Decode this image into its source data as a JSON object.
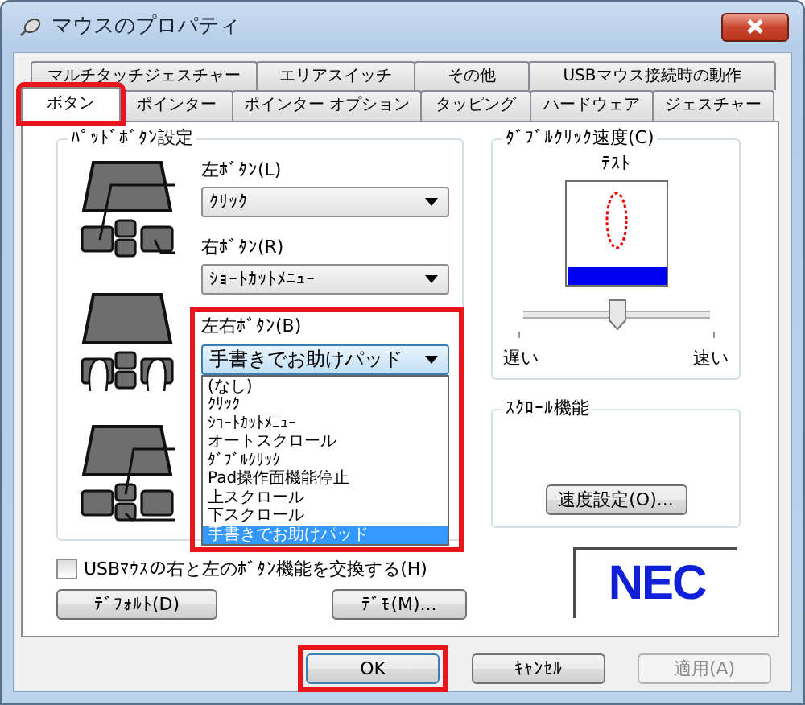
{
  "window": {
    "title": "マウスのプロパティ"
  },
  "tabs": {
    "back_row": [
      {
        "label": "マルチタッチジェスチャー",
        "selected": false
      },
      {
        "label": "エリアスイッチ",
        "selected": false
      },
      {
        "label": "その他",
        "selected": false
      },
      {
        "label": "USBマウス接続時の動作",
        "selected": false
      }
    ],
    "front_row": [
      {
        "label": "ボタン",
        "selected": true,
        "highlighted": true
      },
      {
        "label": "ポインター",
        "selected": false,
        "highlighted": false
      },
      {
        "label": "ポインター オプション",
        "selected": false,
        "highlighted": false
      },
      {
        "label": "タッピング",
        "selected": false,
        "highlighted": false
      },
      {
        "label": "ハードウェア",
        "selected": false,
        "highlighted": false
      },
      {
        "label": "ジェスチャー",
        "selected": false,
        "highlighted": false
      }
    ]
  },
  "pad_button_settings": {
    "title": "ﾊﾟｯﾄﾞﾎﾞﾀﾝ設定",
    "left": {
      "label": "左ﾎﾞﾀﾝ(L)",
      "value": "ｸﾘｯｸ"
    },
    "right": {
      "label": "右ﾎﾞﾀﾝ(R)",
      "value": "ｼｮｰﾄｶｯﾄﾒﾆｭｰ"
    },
    "both": {
      "label": "左右ﾎﾞﾀﾝ(B)",
      "value": "手書きでお助けパッド",
      "highlighted": true,
      "expanded": true,
      "options": [
        {
          "label": "(なし)",
          "selected": false
        },
        {
          "label": "ｸﾘｯｸ",
          "selected": false
        },
        {
          "label": "ｼｮｰﾄｶｯﾄﾒﾆｭｰ",
          "selected": false
        },
        {
          "label": "オートスクロール",
          "selected": false
        },
        {
          "label": "ﾀﾞﾌﾞﾙｸﾘｯｸ",
          "selected": false
        },
        {
          "label": "Pad操作面機能停止",
          "selected": false
        },
        {
          "label": "上スクロール",
          "selected": false
        },
        {
          "label": "下スクロール",
          "selected": false
        },
        {
          "label": "手書きでお助けパッド",
          "selected": true
        }
      ]
    }
  },
  "double_click_speed": {
    "title": "ﾀﾞﾌﾞﾙｸﾘｯｸ速度(C)",
    "test_label": "ﾃｽﾄ",
    "level": 0.5,
    "slow": "遅い",
    "fast": "速い"
  },
  "scroll": {
    "title": "ｽｸﾛｰﾙ機能",
    "button": "速度設定(O)..."
  },
  "swap_checkbox": {
    "label": "USBﾏｳｽの右と左のﾎﾞﾀﾝ機能を交換する(H)",
    "checked": false
  },
  "panel_buttons": [
    {
      "label": "ﾃﾞﾌｫﾙﾄ(D)"
    },
    {
      "label": "ﾃﾞﾓ(M)..."
    }
  ],
  "logo": "NEC",
  "footer_buttons": [
    {
      "label": "OK",
      "highlighted": true,
      "disabled": false
    },
    {
      "label": "ｷｬﾝｾﾙ",
      "highlighted": false,
      "disabled": false
    },
    {
      "label": "適用(A)",
      "highlighted": false,
      "disabled": true
    }
  ]
}
